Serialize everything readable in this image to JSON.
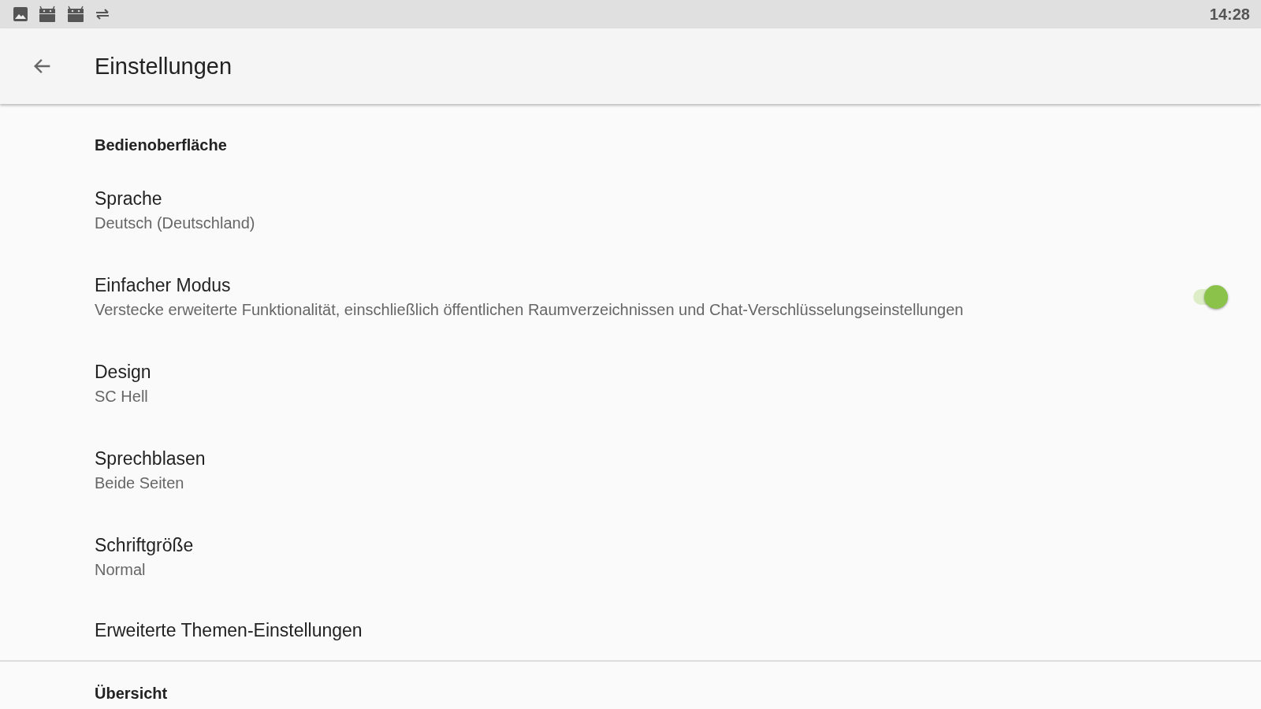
{
  "status_bar": {
    "time": "14:28"
  },
  "app_bar": {
    "title": "Einstellungen"
  },
  "sections": [
    {
      "header": "Bedienoberfläche",
      "items": [
        {
          "kind": "text",
          "title": "Sprache",
          "summary": "Deutsch (Deutschland)"
        },
        {
          "kind": "switch",
          "title": "Einfacher Modus",
          "summary": "Verstecke erweiterte Funktionalität, einschließlich öffentlichen Raumverzeichnissen und Chat-Verschlüsselungseinstellungen",
          "on": true
        },
        {
          "kind": "text",
          "title": "Design",
          "summary": "SC Hell"
        },
        {
          "kind": "text",
          "title": "Sprechblasen",
          "summary": "Beide Seiten"
        },
        {
          "kind": "text",
          "title": "Schriftgröße",
          "summary": "Normal"
        },
        {
          "kind": "text",
          "title": "Erweiterte Themen-Einstellungen"
        }
      ]
    },
    {
      "header": "Übersicht"
    }
  ]
}
